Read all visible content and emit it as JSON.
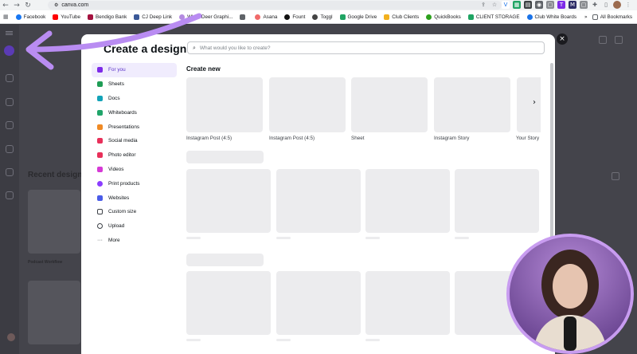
{
  "browser": {
    "url": "canva.com",
    "bookmarks": [
      {
        "label": "Facebook",
        "color": "#1877f2"
      },
      {
        "label": "YouTube",
        "color": "#ff0000"
      },
      {
        "label": "Bendigo Bank",
        "color": "#a4123f"
      },
      {
        "label": "CJ Deep Link",
        "color": "#3b5998"
      },
      {
        "label": "White Deer Graphi...",
        "color": "#b48be0"
      },
      {
        "label": "",
        "color": "#5f6368"
      },
      {
        "label": "Asana",
        "color": "#f06a6a"
      },
      {
        "label": "Fount",
        "color": "#111111"
      },
      {
        "label": "Toggl",
        "color": "#444444"
      },
      {
        "label": "Google Drive",
        "color": "#1fa463"
      },
      {
        "label": "Club Clients",
        "color": "#f2b01e"
      },
      {
        "label": "QuickBooks",
        "color": "#2ca01c"
      },
      {
        "label": "CLIENT STORAGE",
        "color": "#1fa463"
      },
      {
        "label": "Club White Boards",
        "color": "#1a73e8"
      }
    ],
    "all_bookmarks": "All Bookmarks"
  },
  "background": {
    "recent_designs": "Recent designs",
    "podcast_workflow": "Podcast Workflow"
  },
  "modal": {
    "title": "Create a design",
    "search_placeholder": "What would you like to create?",
    "nav": [
      {
        "label": "For you",
        "icon": "sparkle-icon",
        "color": "#7d2ae8"
      },
      {
        "label": "Sheets",
        "icon": "sheets-icon",
        "color": "#1f9d55"
      },
      {
        "label": "Docs",
        "icon": "docs-icon",
        "color": "#13a3b8"
      },
      {
        "label": "Whiteboards",
        "icon": "whiteboard-icon",
        "color": "#20a56a"
      },
      {
        "label": "Presentations",
        "icon": "presentation-icon",
        "color": "#f08a24"
      },
      {
        "label": "Social media",
        "icon": "social-media-icon",
        "color": "#e8305a"
      },
      {
        "label": "Photo editor",
        "icon": "photo-editor-icon",
        "color": "#e8305a"
      },
      {
        "label": "Videos",
        "icon": "video-icon",
        "color": "#d63ad6"
      },
      {
        "label": "Print products",
        "icon": "print-icon",
        "color": "#8b3dff"
      },
      {
        "label": "Websites",
        "icon": "website-icon",
        "color": "#4a5ce8"
      },
      {
        "label": "Custom size",
        "icon": "custom-size-icon",
        "color": "#3d4147"
      },
      {
        "label": "Upload",
        "icon": "upload-icon",
        "color": "#3d4147"
      },
      {
        "label": "More",
        "icon": "more-icon",
        "color": "#3d4147"
      }
    ],
    "create_new": "Create new",
    "templates": [
      {
        "label": "Instagram Post (4:5)"
      },
      {
        "label": "Instagram Post (4:5)"
      },
      {
        "label": "Sheet"
      },
      {
        "label": "Instagram Story"
      },
      {
        "label": "Your Story"
      }
    ]
  }
}
